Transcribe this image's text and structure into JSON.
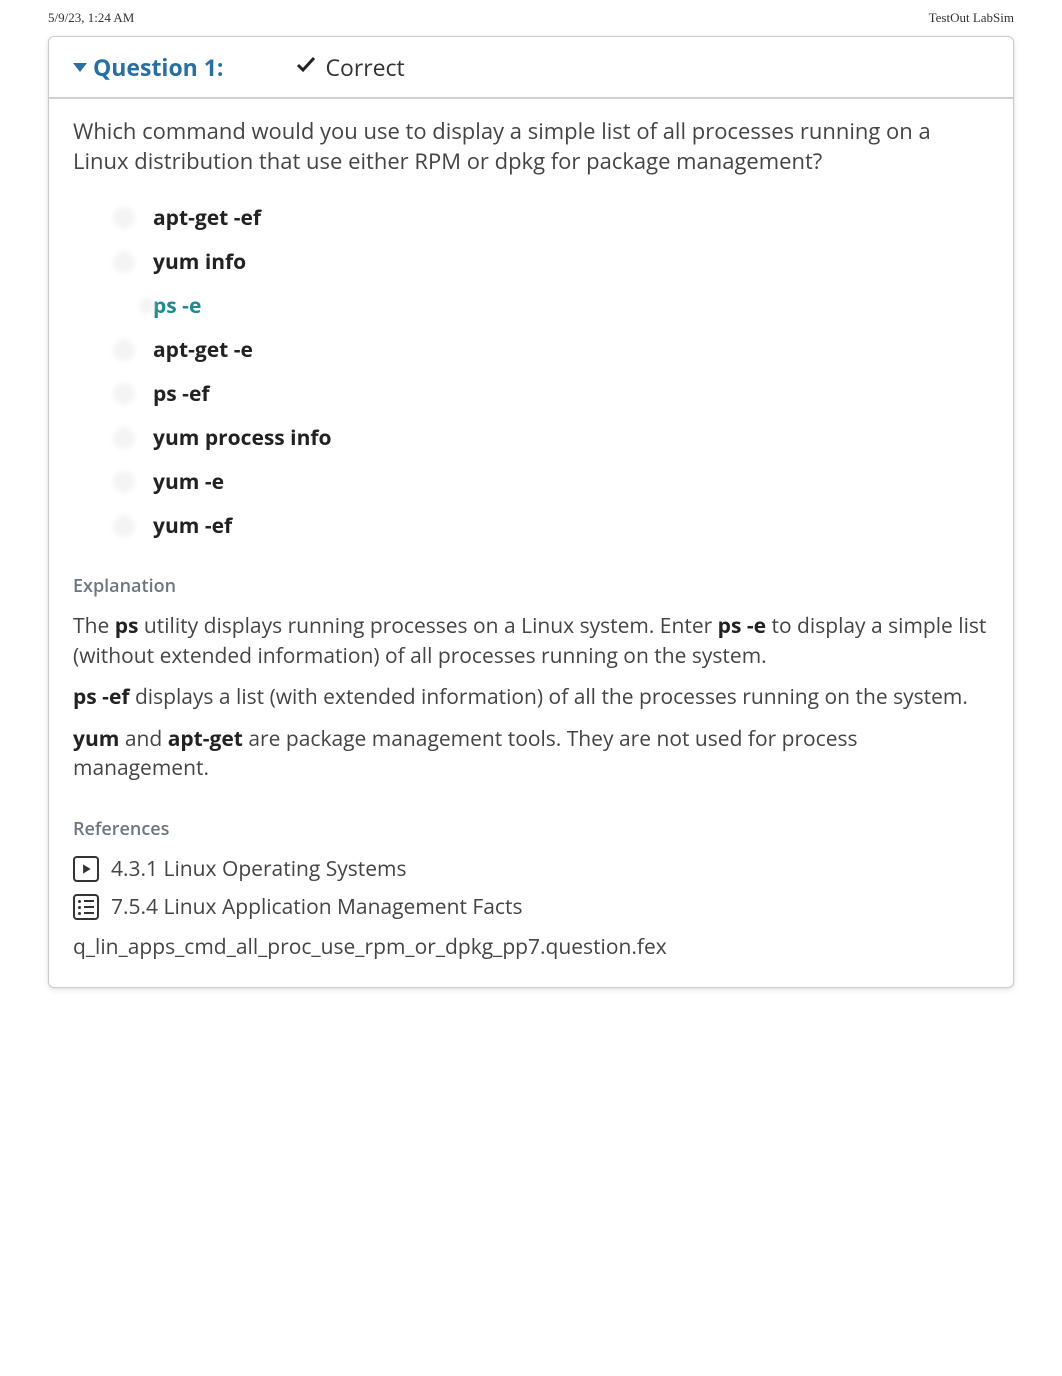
{
  "header": {
    "timestamp": "5/9/23, 1:24 AM",
    "title": "TestOut LabSim"
  },
  "question": {
    "label": "Question 1:",
    "status": "Correct",
    "prompt": "Which command would you use to display a simple list of all processes running on a Linux distribution that use either RPM or dpkg for package management?",
    "options": [
      {
        "text": "apt-get -ef",
        "correct": false
      },
      {
        "text": "yum info",
        "correct": false
      },
      {
        "text": "ps -e",
        "correct": true
      },
      {
        "text": "apt-get -e",
        "correct": false
      },
      {
        "text": "ps -ef",
        "correct": false
      },
      {
        "text": "yum process info",
        "correct": false
      },
      {
        "text": "yum -e",
        "correct": false
      },
      {
        "text": "yum -ef",
        "correct": false
      }
    ]
  },
  "explanation": {
    "heading": "Explanation",
    "p1_a": "The ",
    "p1_b1": "ps",
    "p1_c": " utility displays running processes on a Linux system. Enter ",
    "p1_b2": "ps -e",
    "p1_d": " to display a simple list (without extended information) of all processes running on the system.",
    "p2_b": "ps -ef",
    "p2_t": " displays a list (with extended information) of all the processes running on the system.",
    "p3_b1": "yum",
    "p3_mid": " and ",
    "p3_b2": "apt-get",
    "p3_t": " are package management tools. They are not used for process management."
  },
  "references": {
    "heading": "References",
    "items": [
      {
        "icon": "video",
        "text": "4.3.1 Linux Operating Systems"
      },
      {
        "icon": "list",
        "text": "7.5.4 Linux Application Management Facts"
      }
    ],
    "file_id": "q_lin_apps_cmd_all_proc_use_rpm_or_dpkg_pp7.question.fex"
  }
}
